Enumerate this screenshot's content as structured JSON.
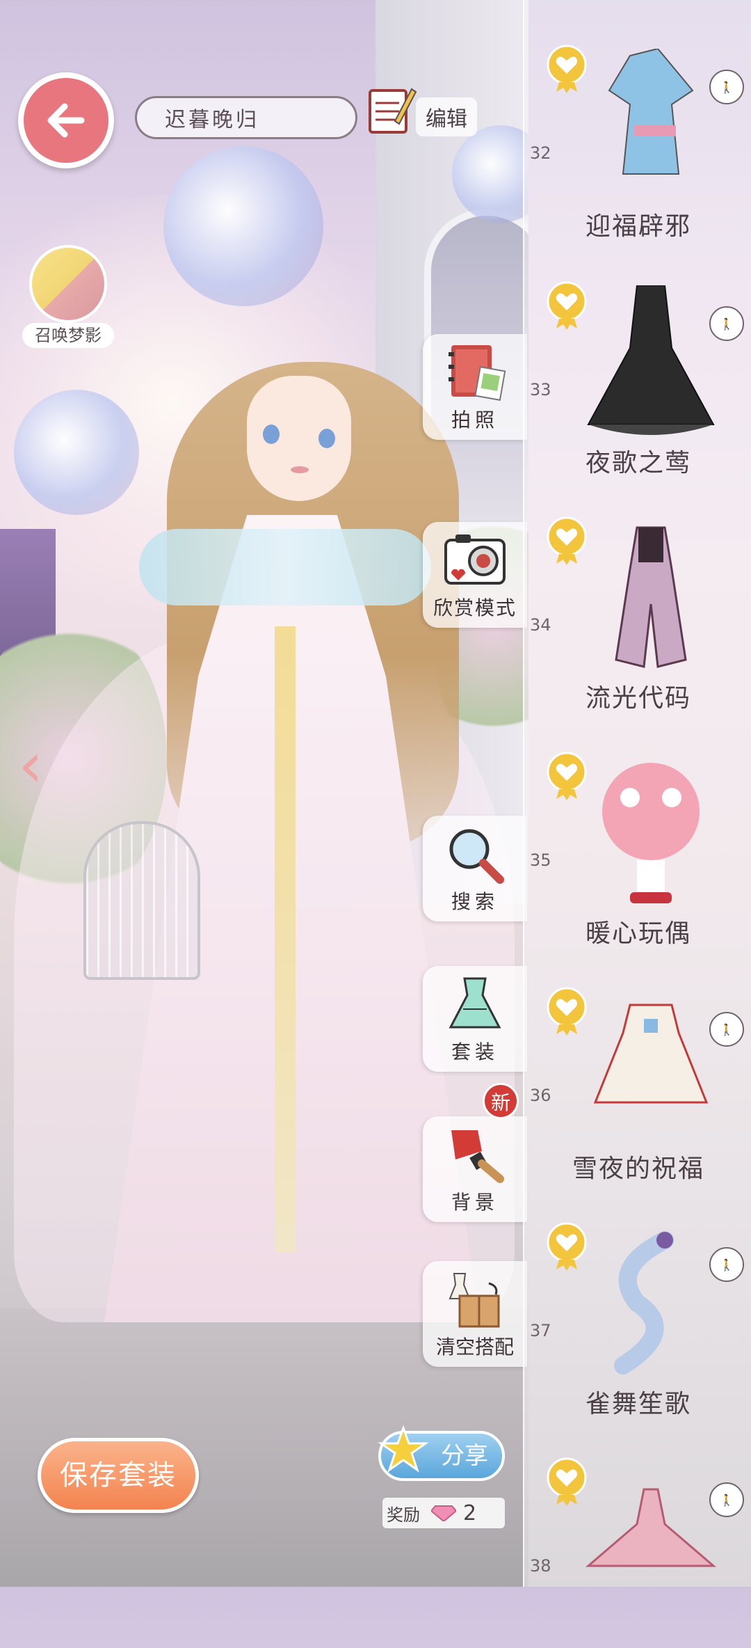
{
  "header": {
    "outfit_name": "迟暮晚归",
    "edit_label": "编辑",
    "summon_label": "召唤梦影"
  },
  "side_buttons": [
    {
      "label": "拍照",
      "icon": "photo-album-icon"
    },
    {
      "label": "欣赏模式",
      "icon": "camera-icon"
    },
    {
      "label": "搜索",
      "icon": "search-icon"
    },
    {
      "label": "套装",
      "icon": "dress-icon"
    },
    {
      "label": "背景",
      "icon": "paint-brush-icon"
    },
    {
      "label": "清空搭配",
      "icon": "box-icon"
    }
  ],
  "new_badge": "新",
  "footer": {
    "save_label": "保存套装",
    "share_label": "分享",
    "reward_label": "奖励",
    "reward_count": "2"
  },
  "suits": [
    {
      "number": "32",
      "name": "迎福辟邪",
      "color": "#8fc3e6"
    },
    {
      "number": "33",
      "name": "夜歌之莺",
      "color": "#2b2b2b"
    },
    {
      "number": "34",
      "name": "流光代码",
      "color": "#c9a9c4"
    },
    {
      "number": "35",
      "name": "暖心玩偶",
      "color": "#f4a5b5"
    },
    {
      "number": "36",
      "name": "雪夜的祝福",
      "color": "#f6efe6"
    },
    {
      "number": "37",
      "name": "雀舞笙歌",
      "color": "#b7cbe8"
    },
    {
      "number": "38",
      "name": "",
      "color": "#eab3bf"
    }
  ]
}
